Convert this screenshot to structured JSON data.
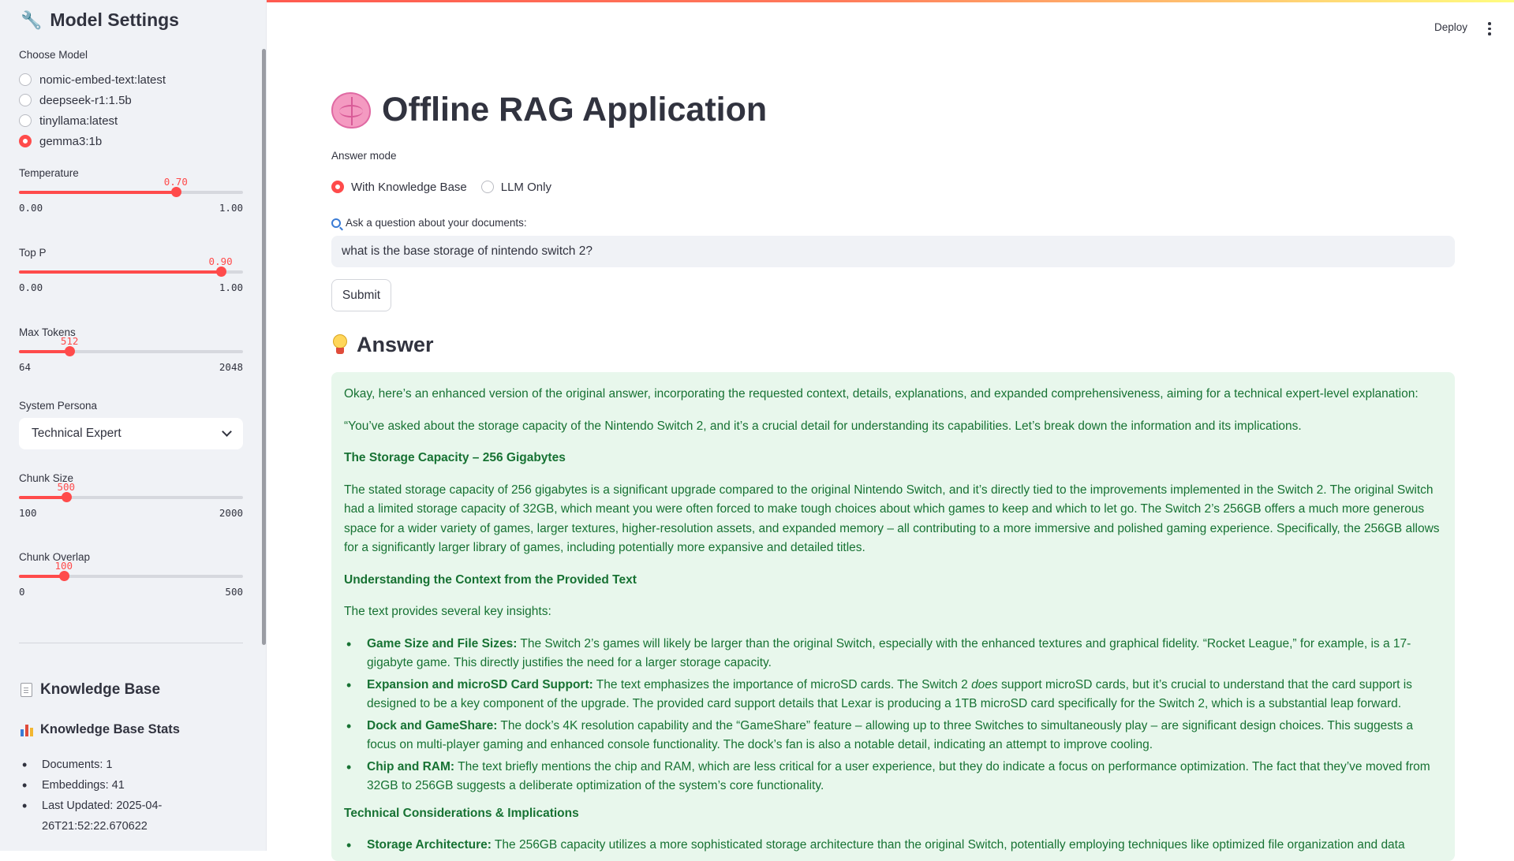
{
  "sidebar": {
    "title": "Model Settings",
    "title_icon": "wrench-icon",
    "choose_model_label": "Choose Model",
    "models": [
      {
        "label": "nomic-embed-text:latest",
        "selected": false
      },
      {
        "label": "deepseek-r1:1.5b",
        "selected": false
      },
      {
        "label": "tinyllama:latest",
        "selected": false
      },
      {
        "label": "gemma3:1b",
        "selected": true
      }
    ],
    "sliders": [
      {
        "id": "temperature",
        "label": "Temperature",
        "value": "0.70",
        "min": "0.00",
        "max": "1.00",
        "fraction": 0.7
      },
      {
        "id": "top-p",
        "label": "Top P",
        "value": "0.90",
        "min": "0.00",
        "max": "1.00",
        "fraction": 0.9
      },
      {
        "id": "max-tokens",
        "label": "Max Tokens",
        "value": "512",
        "min": "64",
        "max": "2048",
        "fraction": 0.2258
      },
      {
        "id": "chunk-size",
        "label": "Chunk Size",
        "value": "500",
        "min": "100",
        "max": "2000",
        "fraction": 0.2105
      },
      {
        "id": "chunk-overlap",
        "label": "Chunk Overlap",
        "value": "100",
        "min": "0",
        "max": "500",
        "fraction": 0.2
      }
    ],
    "persona_label": "System Persona",
    "persona_value": "Technical Expert",
    "knowledge_base_title": "Knowledge Base",
    "kb_stats_title": "Knowledge Base Stats",
    "kb_stats": [
      "Documents: 1",
      "Embeddings: 41",
      "Last Updated: 2025-04-26T21:52:22.670622"
    ]
  },
  "header": {
    "deploy_label": "Deploy"
  },
  "main": {
    "title": "Offline RAG Application",
    "answer_mode_label": "Answer mode",
    "answer_modes": [
      {
        "label": "With Knowledge Base",
        "selected": true
      },
      {
        "label": "LLM Only",
        "selected": false
      }
    ],
    "question_label": "Ask a question about your documents:",
    "question_value": "what is the base storage of nintendo switch 2?",
    "submit_label": "Submit",
    "answer_heading": "Answer",
    "answer": {
      "intro": "Okay, here’s an enhanced version of the original answer, incorporating the requested context, details, explanations, and expanded comprehensiveness, aiming for a technical expert-level explanation:",
      "quote_open": "“You’ve asked about the storage capacity of the Nintendo Switch 2, and it’s a crucial detail for understanding its capabilities. Let’s break down the information and its implications.",
      "h1": "The Storage Capacity – 256 Gigabytes",
      "p1": "The stated storage capacity of 256 gigabytes is a significant upgrade compared to the original Nintendo Switch, and it’s directly tied to the improvements implemented in the Switch 2. The original Switch had a limited storage capacity of 32GB, which meant you were often forced to make tough choices about which games to keep and which to let go. The Switch 2’s 256GB offers a much more generous space for a wider variety of games, larger textures, higher-resolution assets, and expanded memory – all contributing to a more immersive and polished gaming experience. Specifically, the 256GB allows for a significantly larger library of games, including potentially more expansive and detailed titles.",
      "h2": "Understanding the Context from the Provided Text",
      "p2": "The text provides several key insights:",
      "bullets": [
        {
          "term": "Game Size and File Sizes:",
          "text": " The Switch 2’s games will likely be larger than the original Switch, especially with the enhanced textures and graphical fidelity. “Rocket League,” for example, is a 17-gigabyte game. This directly justifies the need for a larger storage capacity."
        },
        {
          "term": "Expansion and microSD Card Support:",
          "text_a": " The text emphasizes the importance of microSD cards. The Switch 2 ",
          "em": "does",
          "text_b": " support microSD cards, but it’s crucial to understand that the card support is designed to be a key component of the upgrade. The provided card support details that Lexar is producing a 1TB microSD card specifically for the Switch 2, which is a substantial leap forward."
        },
        {
          "term": "Dock and GameShare:",
          "text": " The dock’s 4K resolution capability and the “GameShare” feature – allowing up to three Switches to simultaneously play – are significant design choices. This suggests a focus on multi-player gaming and enhanced console functionality. The dock’s fan is also a notable detail, indicating an attempt to improve cooling."
        },
        {
          "term": "Chip and RAM:",
          "text": " The text briefly mentions the chip and RAM, which are less critical for a user experience, but they do indicate a focus on performance optimization. The fact that they’ve moved from 32GB to 256GB suggests a deliberate optimization of the system’s core functionality."
        }
      ],
      "h3": "Technical Considerations & Implications",
      "bullets2": [
        {
          "term": "Storage Architecture:",
          "text": " The 256GB capacity utilizes a more sophisticated storage architecture than the original Switch, potentially employing techniques like optimized file organization and data"
        }
      ]
    }
  },
  "colors": {
    "accent": "#ff4b4b",
    "sidebar_bg": "#f0f2f6",
    "answer_bg": "#e8f7ec",
    "answer_text": "#177233"
  }
}
